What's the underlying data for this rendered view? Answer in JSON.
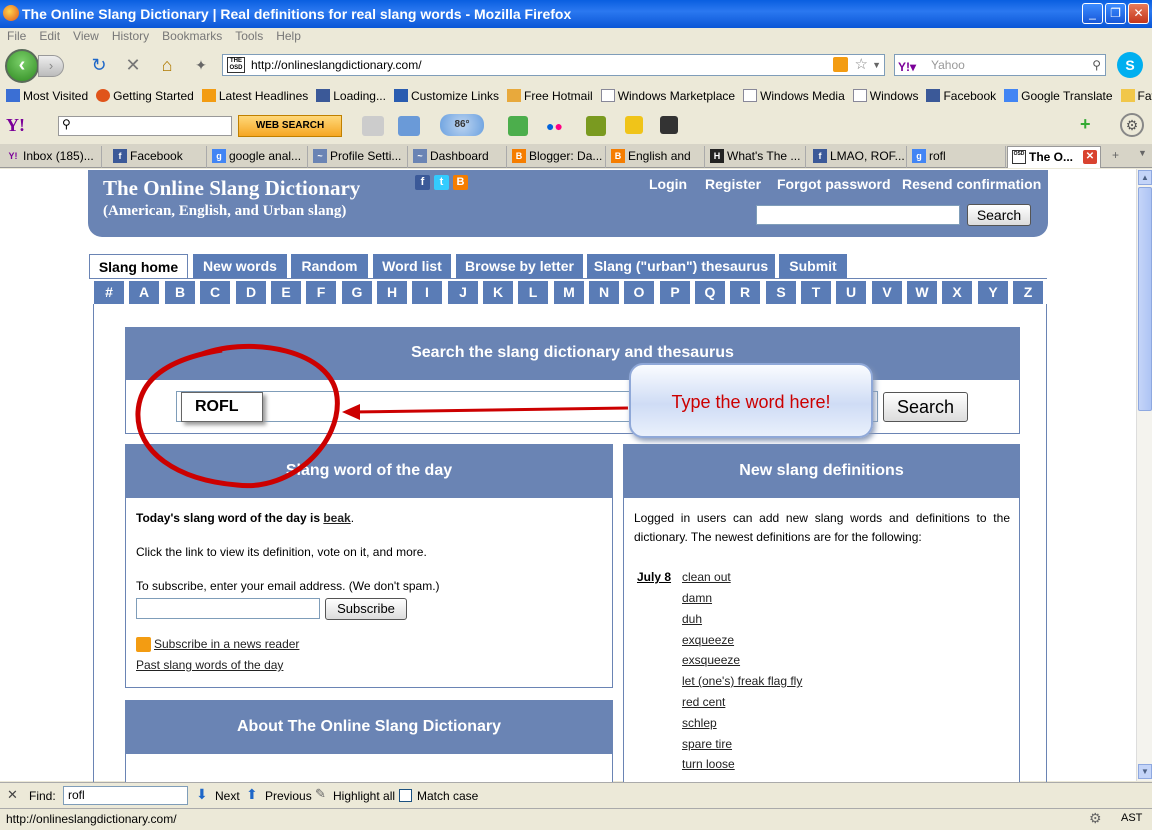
{
  "window": {
    "title": "The Online Slang Dictionary | Real definitions for real slang words - Mozilla Firefox",
    "min": "_",
    "max": "❐",
    "close": "✕"
  },
  "menu": [
    "File",
    "Edit",
    "View",
    "History",
    "Bookmarks",
    "Tools",
    "Help"
  ],
  "nav": {
    "url": "http://onlineslangdictionary.com/",
    "osd": "THE OSD",
    "search_engine": "Yahoo",
    "search_placeholder": "Yahoo"
  },
  "bookmarks": [
    "Most Visited",
    "Getting Started",
    "Latest Headlines",
    "Loading...",
    "Customize Links",
    "Free Hotmail",
    "Windows Marketplace",
    "Windows Media",
    "Windows",
    "Facebook",
    "Google Translate",
    "Favorites"
  ],
  "yahoo": {
    "logo": "Y!",
    "button": "WEB SEARCH",
    "weather": "86°"
  },
  "tabs": [
    {
      "label": "Inbox (185)...",
      "icon": "Y!",
      "color": "#7b0099"
    },
    {
      "label": "Facebook",
      "icon": "f",
      "color": "#3b5998"
    },
    {
      "label": "google anal...",
      "icon": "g",
      "color": "#4285f4"
    },
    {
      "label": "Profile Setti...",
      "icon": "~",
      "color": "#6a84b4"
    },
    {
      "label": "Dashboard -...",
      "icon": "~",
      "color": "#6a84b4"
    },
    {
      "label": "Blogger: Da...",
      "icon": "B",
      "color": "#f57d00"
    },
    {
      "label": "English and ...",
      "icon": "B",
      "color": "#f57d00"
    },
    {
      "label": "What's The ...",
      "icon": "H",
      "color": "#222"
    },
    {
      "label": "LMAO, ROF...",
      "icon": "f",
      "color": "#3b5998"
    },
    {
      "label": "rofl meaning...",
      "icon": "g",
      "color": "#4285f4"
    },
    {
      "label": "The O...",
      "icon": "OSD",
      "color": "#fff"
    }
  ],
  "site": {
    "title": "The Online Slang Dictionary",
    "subtitle": "(American, English, and Urban slang)",
    "links": [
      "Login",
      "Register",
      "Forgot password",
      "Resend confirmation"
    ],
    "search_button": "Search"
  },
  "site_tabs": [
    "Slang home",
    "New words",
    "Random",
    "Word list",
    "Browse by letter",
    "Slang (\"urban\") thesaurus",
    "Submit"
  ],
  "letters": [
    "#",
    "A",
    "B",
    "C",
    "D",
    "E",
    "F",
    "G",
    "H",
    "I",
    "J",
    "K",
    "L",
    "M",
    "N",
    "O",
    "P",
    "Q",
    "R",
    "S",
    "T",
    "U",
    "V",
    "W",
    "X",
    "Y",
    "Z"
  ],
  "search_panel": {
    "heading": "Search the slang dictionary and thesaurus",
    "button": "Search",
    "typed": "ROFL",
    "callout": "Type the word here!"
  },
  "wotd": {
    "heading": "Slang word of the day",
    "line1_prefix": "Today's slang word of the day is ",
    "word": "beak",
    "line1_suffix": ".",
    "line2": "Click the link to view its definition, vote on it, and more.",
    "line3": "To subscribe, enter your email address. (We don't spam.)",
    "subscribe_button": "Subscribe",
    "rss_link": "Subscribe in a news reader",
    "past_link": "Past slang words of the day"
  },
  "new_defs": {
    "heading": "New slang definitions",
    "intro": "Logged in users can add new slang words and definitions to the dictionary. The newest definitions are for the following:",
    "date": "July 8",
    "words": [
      "clean out",
      "damn",
      "duh",
      "exqueeze",
      "exsqueeze",
      "let (one's) freak flag fly",
      "red cent",
      "schlep",
      "spare tire",
      "turn loose"
    ]
  },
  "about": {
    "heading": "About The Online Slang Dictionary"
  },
  "find": {
    "label": "Find:",
    "value": "rofl",
    "next": "Next",
    "previous": "Previous",
    "highlight": "Highlight all",
    "match": "Match case"
  },
  "status": {
    "url": "http://onlineslangdictionary.com/",
    "locale": "AST"
  }
}
